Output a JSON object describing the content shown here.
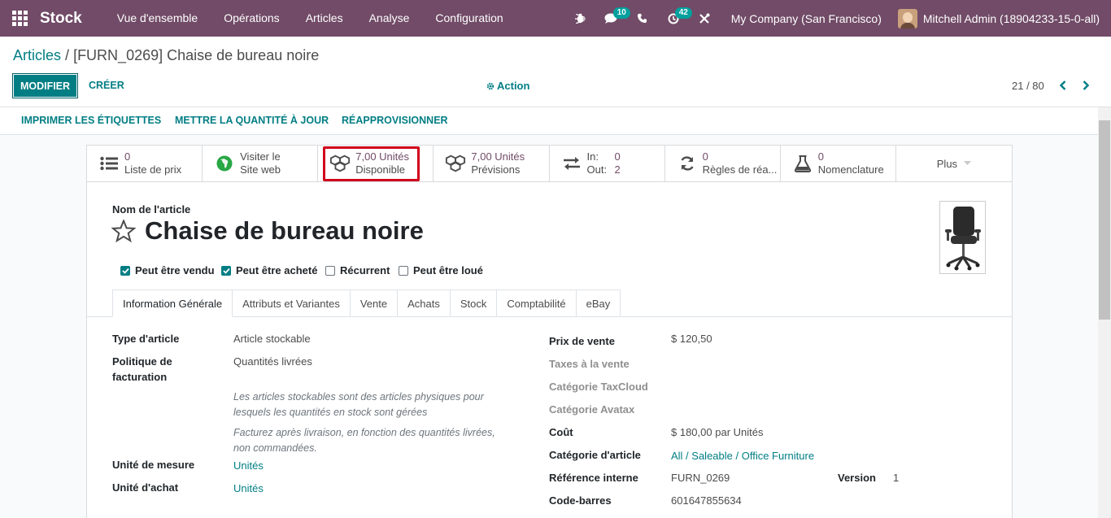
{
  "navbar": {
    "app_name": "Stock",
    "menu": [
      "Vue d'ensemble",
      "Opérations",
      "Articles",
      "Analyse",
      "Configuration"
    ],
    "chat_count": "10",
    "activity_count": "42",
    "company": "My Company (San Francisco)",
    "user": "Mitchell Admin (18904233-15-0-all)"
  },
  "breadcrumb": {
    "parent": "Articles",
    "separator": "/",
    "current": "[FURN_0269] Chaise de bureau noire"
  },
  "controls": {
    "edit": "MODIFIER",
    "create": "CRÉER",
    "action": "Action",
    "pager": "21 / 80"
  },
  "statusbar": {
    "print_labels": "IMPRIMER LES ÉTIQUETTES",
    "update_qty": "METTRE LA QUANTITÉ À JOUR",
    "replenish": "RÉAPPROVISIONNER"
  },
  "smart_buttons": {
    "pricelist": {
      "value": "0",
      "label": "Liste de prix"
    },
    "website": {
      "line1": "Visiter le",
      "line2": "Site web"
    },
    "available": {
      "value": "7,00 Unités",
      "label": "Disponible"
    },
    "forecast": {
      "value": "7,00 Unités",
      "label": "Prévisions"
    },
    "inout": {
      "in_label": "In:",
      "in_value": "0",
      "out_label": "Out:",
      "out_value": "2"
    },
    "rules": {
      "value": "0",
      "label": "Règles de réa..."
    },
    "bom": {
      "value": "0",
      "label": "Nomenclature"
    },
    "more": "Plus"
  },
  "product": {
    "name_label": "Nom de l'article",
    "name": "Chaise de bureau noire",
    "checkboxes": [
      {
        "label": "Peut être vendu",
        "checked": true
      },
      {
        "label": "Peut être acheté",
        "checked": true
      },
      {
        "label": "Récurrent",
        "checked": false
      },
      {
        "label": "Peut être loué",
        "checked": false
      }
    ]
  },
  "tabs": [
    "Information Générale",
    "Attributs et Variantes",
    "Vente",
    "Achats",
    "Stock",
    "Comptabilité",
    "eBay"
  ],
  "general": {
    "type_label": "Type d'article",
    "type_value": "Article stockable",
    "invoice_label_1": "Politique de",
    "invoice_label_2": "facturation",
    "invoice_value": "Quantités livrées",
    "help1_line1": "Les articles stockables sont des articles physiques pour",
    "help1_line2": "lesquels les quantités en stock sont gérées",
    "help2_line1": "Facturez après livraison, en fonction des quantités livrées,",
    "help2_line2": "non commandées.",
    "uom_label": "Unité de mesure",
    "uom_value": "Unités",
    "purchase_uom_label": "Unité d'achat",
    "purchase_uom_value": "Unités",
    "sale_price_label": "Prix de vente",
    "sale_price_value": "$ 120,50",
    "sale_tax_label": "Taxes à la vente",
    "taxcloud_label": "Catégorie TaxCloud",
    "avatax_label": "Catégorie Avatax",
    "cost_label": "Coût",
    "cost_value": "$ 180,00",
    "cost_unit": "par Unités",
    "category_label": "Catégorie d'article",
    "category_value": "All / Saleable / Office Furniture",
    "ref_label": "Référence interne",
    "ref_value": "FURN_0269",
    "version_label": "Version",
    "version_value": "1",
    "barcode_label": "Code-barres",
    "barcode_value": "601647855634"
  }
}
